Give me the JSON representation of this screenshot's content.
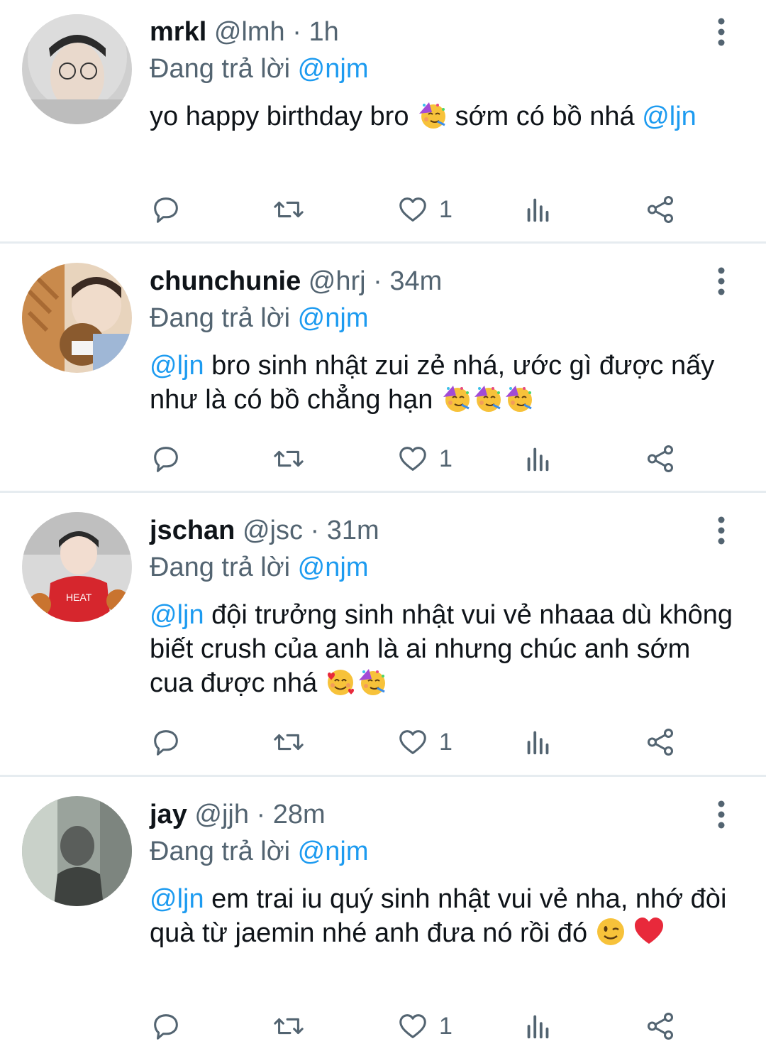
{
  "tweets": [
    {
      "name": "mrkl",
      "handle": "@lmh",
      "time": "1h",
      "reply_prefix": "Đang trả lời",
      "reply_to": "@njm",
      "body_parts": [
        {
          "type": "text",
          "text": "yo happy birthday bro "
        },
        {
          "type": "emoji",
          "name": "partying-face-emoji"
        },
        {
          "type": "text",
          "text": " sớm có bồ nhá "
        },
        {
          "type": "mention",
          "text": "@ljn"
        }
      ],
      "like_count": "1"
    },
    {
      "name": "chunchunie",
      "handle": "@hrj",
      "time": "34m",
      "reply_prefix": "Đang trả lời",
      "reply_to": "@njm",
      "body_parts": [
        {
          "type": "mention",
          "text": "@ljn"
        },
        {
          "type": "text",
          "text": " bro sinh nhật zui zẻ nhá, ước gì được nấy như là có bồ chẳng hạn "
        },
        {
          "type": "emoji",
          "name": "partying-face-emoji"
        },
        {
          "type": "emoji",
          "name": "partying-face-emoji"
        },
        {
          "type": "emoji",
          "name": "partying-face-emoji"
        }
      ],
      "like_count": "1"
    },
    {
      "name": "jschan",
      "handle": "@jsc",
      "time": "31m",
      "reply_prefix": "Đang trả lời",
      "reply_to": "@njm",
      "body_parts": [
        {
          "type": "mention",
          "text": "@ljn"
        },
        {
          "type": "text",
          "text": " đội trưởng sinh nhật vui vẻ nhaaa dù không biết crush của anh là ai nhưng chúc anh sớm cua được nhá "
        },
        {
          "type": "emoji",
          "name": "smiling-face-with-hearts-emoji"
        },
        {
          "type": "emoji",
          "name": "partying-face-emoji"
        }
      ],
      "like_count": "1"
    },
    {
      "name": "jay",
      "handle": "@jjh",
      "time": "28m",
      "reply_prefix": "Đang trả lời",
      "reply_to": "@njm",
      "body_parts": [
        {
          "type": "mention",
          "text": "@ljn"
        },
        {
          "type": "text",
          "text": " em trai iu quý sinh nhật vui vẻ nha, nhớ đòi quà từ jaemin nhé anh đưa nó rồi đó "
        },
        {
          "type": "emoji",
          "name": "winking-face-emoji"
        },
        {
          "type": "text",
          "text": " "
        },
        {
          "type": "emoji",
          "name": "red-heart-emoji"
        }
      ],
      "like_count": "1"
    }
  ],
  "colors": {
    "accent": "#1d9bf0",
    "secondary_text": "#536471",
    "primary_text": "#0f1419",
    "separator": "#e6ecf0"
  },
  "icons": [
    "reply-icon",
    "retweet-icon",
    "like-icon",
    "views-icon",
    "share-icon",
    "more-options-icon"
  ]
}
